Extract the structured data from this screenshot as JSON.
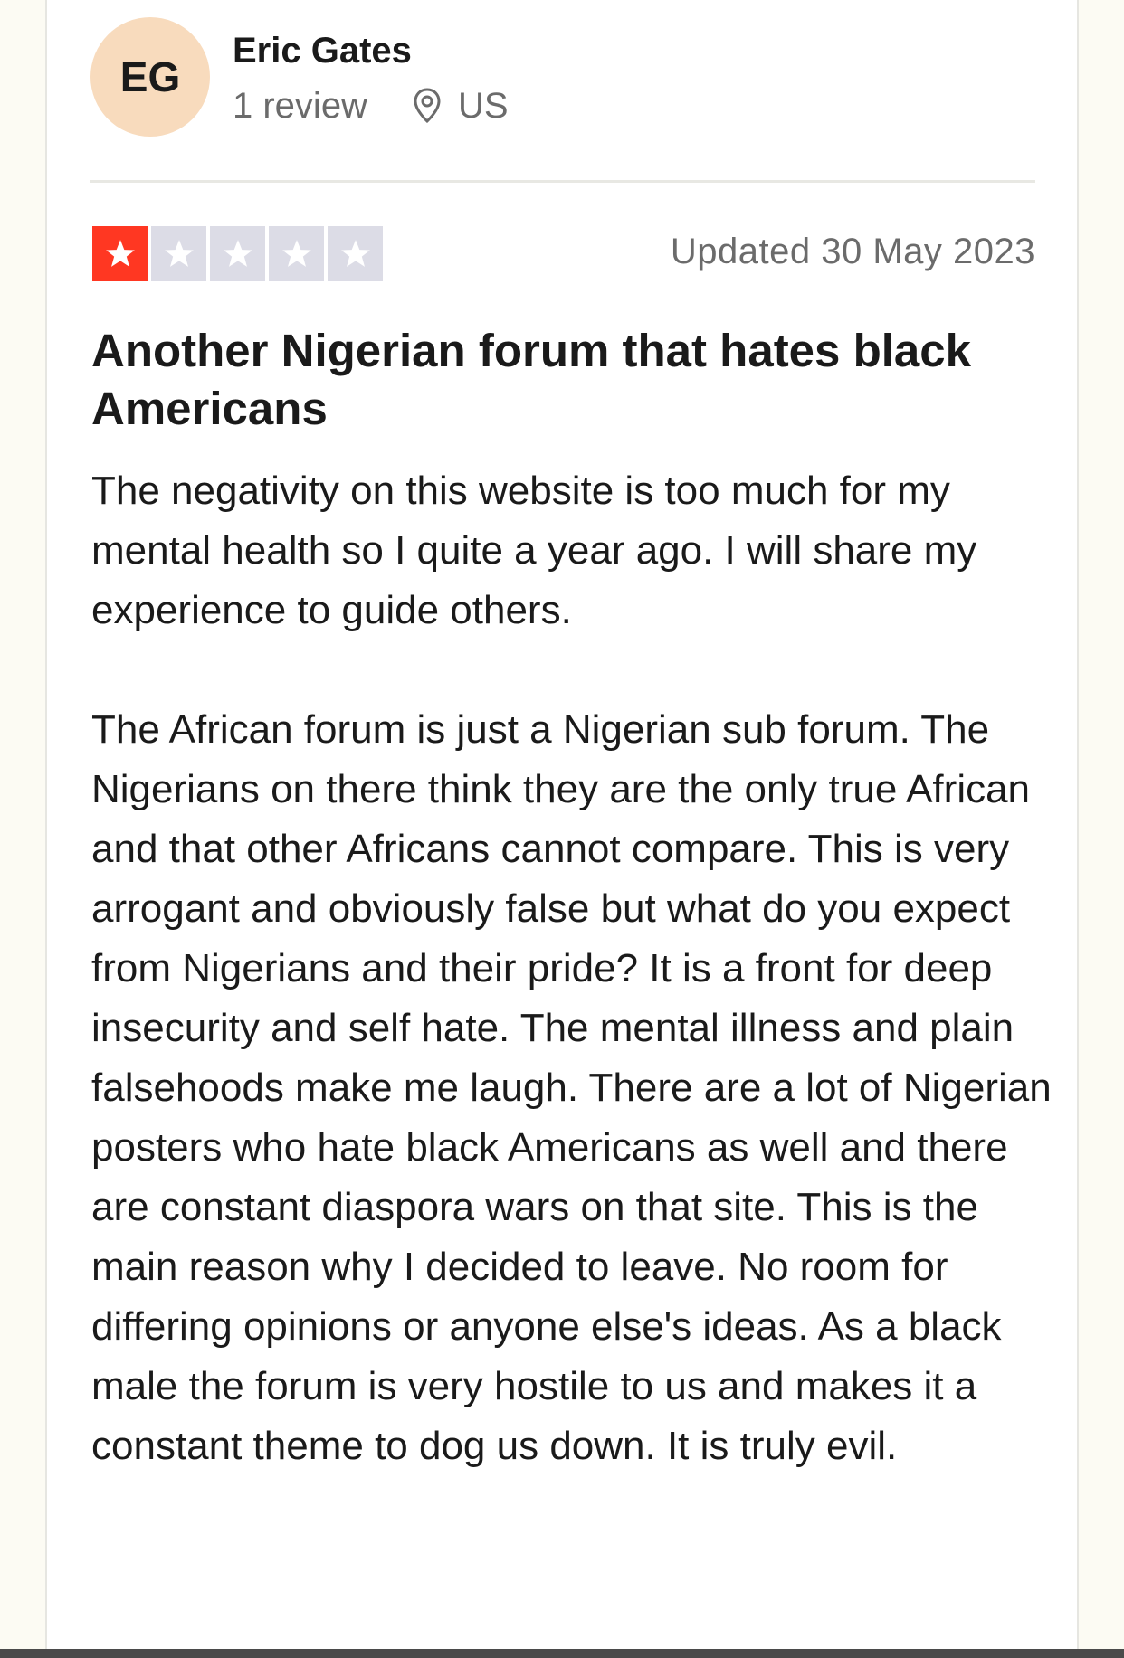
{
  "reviewer": {
    "initials": "EG",
    "name": "Eric Gates",
    "review_count": "1 review",
    "location_icon": "location-pin-icon",
    "country": "US"
  },
  "review": {
    "rating": 1,
    "rating_max": 5,
    "star_icon": "star-icon",
    "date": "Updated 30 May 2023",
    "title": "Another Nigerian forum that hates black Americans",
    "paragraphs": [
      "The negativity on this website is too much for my mental health so I quite a year ago. I will share my experience to guide others.",
      "The African forum is just a Nigerian sub forum. The Nigerians on there think they are the only true African and that other Africans cannot compare. This is very arrogant and obviously false but what do you expect from Nigerians and their pride? It is a front for deep insecurity and self hate. The mental illness and plain falsehoods make me laugh. There are a lot of Nigerian posters who hate black Americans as well and there are constant diaspora wars on that site. This is the main reason why I decided to leave. No room for differing opinions or anyone else's ideas. As a black male the forum is very hostile to us and makes it a constant theme to dog us down. It is truly evil."
    ]
  },
  "colors": {
    "star_filled": "#ff3722",
    "star_empty": "#dcdce6",
    "avatar_bg": "#f8dbbd",
    "page_bg": "#fcfbf3",
    "muted_text": "#6b6b6b"
  }
}
